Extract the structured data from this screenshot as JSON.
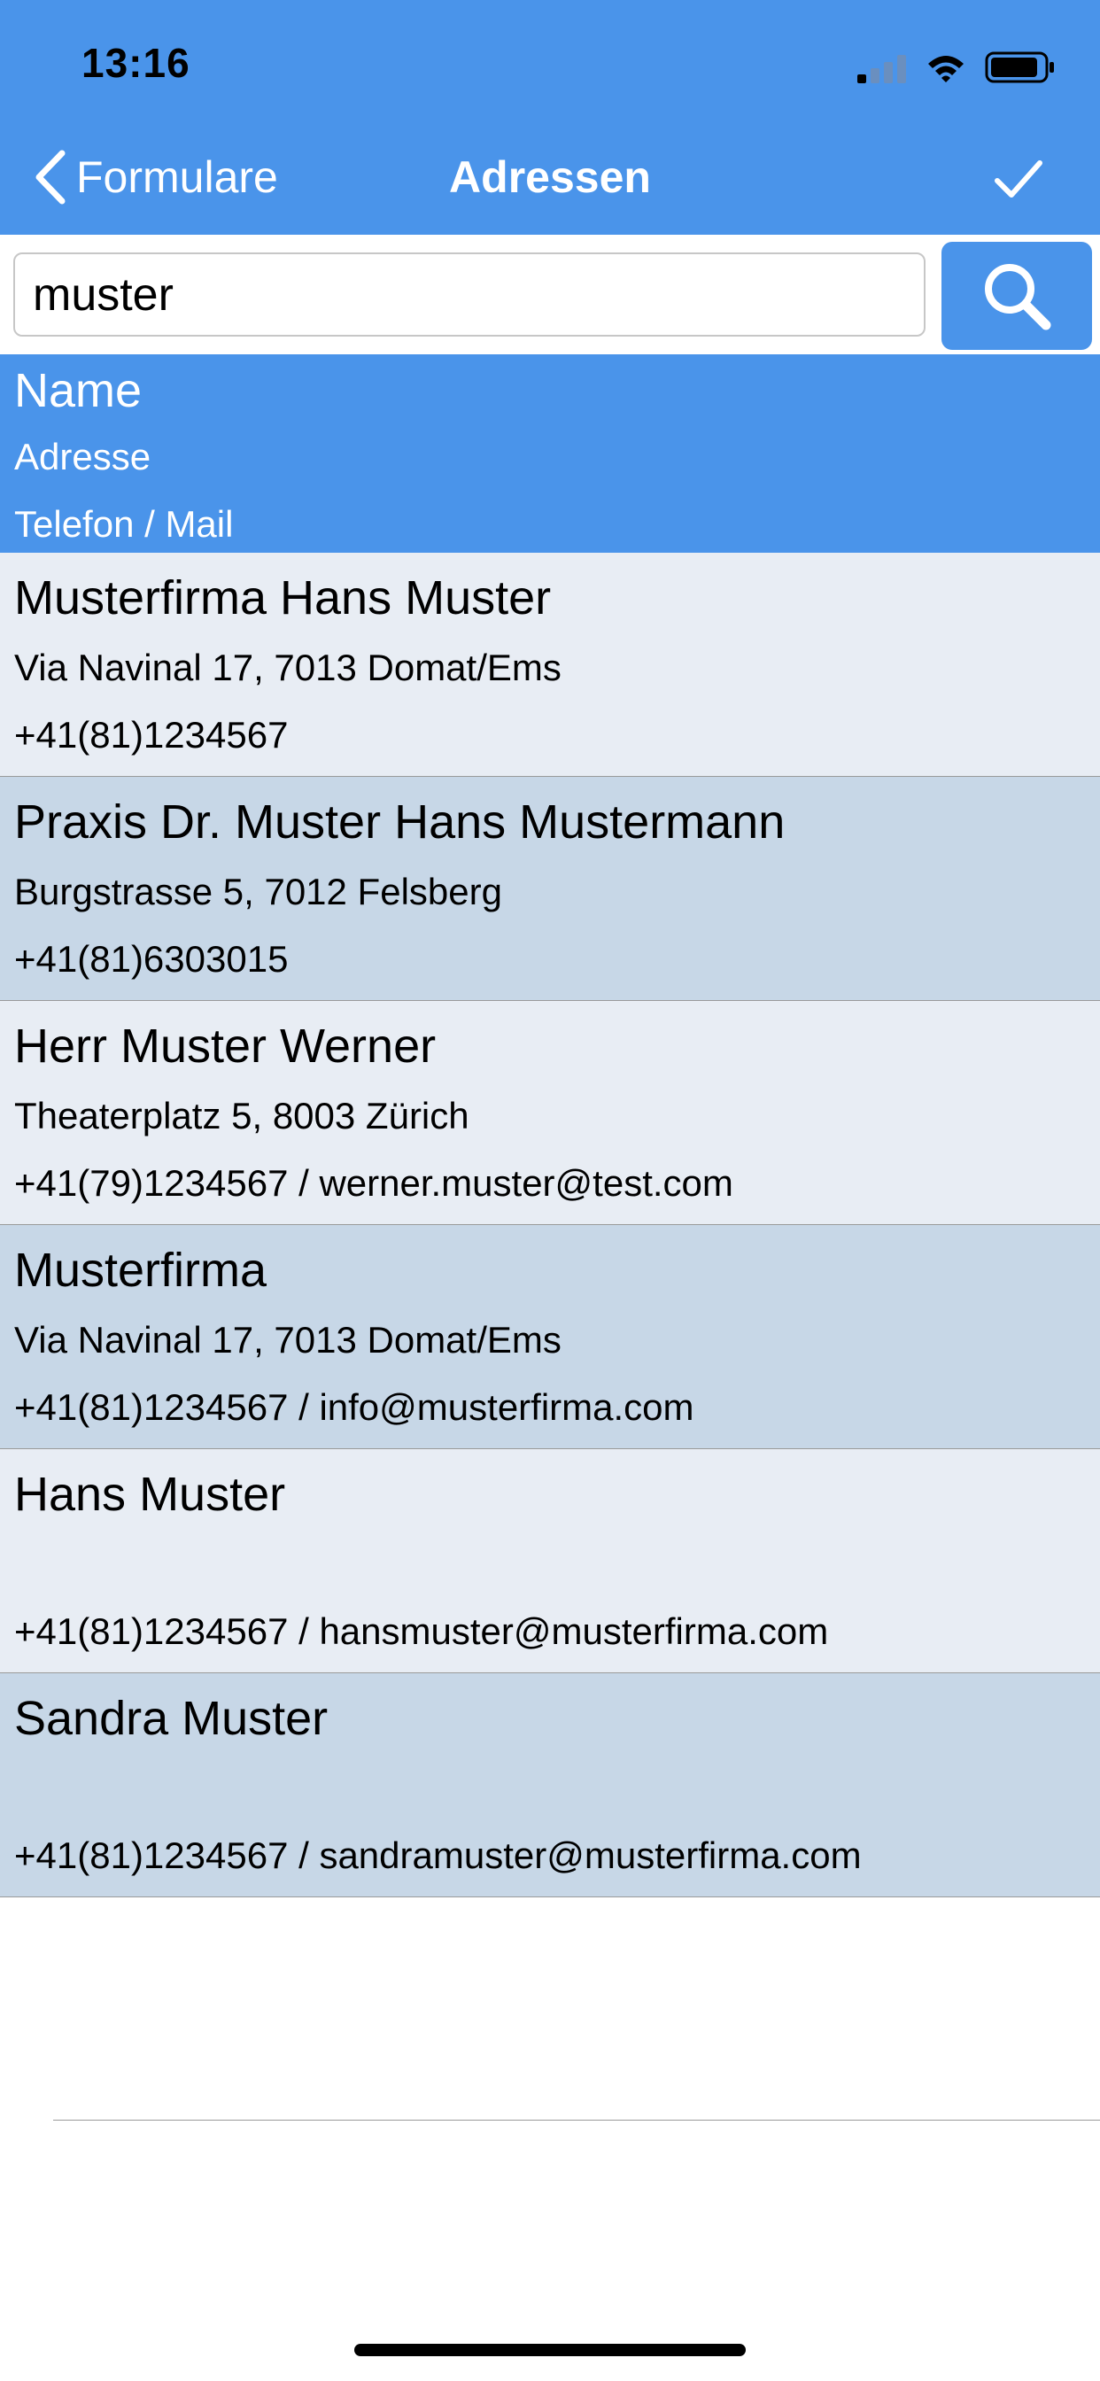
{
  "status_bar": {
    "time": "13:16"
  },
  "nav": {
    "back_label": "Formulare",
    "title": "Adressen"
  },
  "search": {
    "value": "muster",
    "placeholder": ""
  },
  "list_header": {
    "name": "Name",
    "address": "Adresse",
    "contact": "Telefon / Mail"
  },
  "rows": [
    {
      "name": "Musterfirma Hans Muster",
      "address": "Via Navinal 17, 7013 Domat/Ems",
      "contact": "+41(81)1234567"
    },
    {
      "name": "Praxis Dr. Muster Hans Mustermann",
      "address": "Burgstrasse 5, 7012 Felsberg",
      "contact": "+41(81)6303015"
    },
    {
      "name": "Herr Muster Werner",
      "address": "Theaterplatz 5, 8003 Zürich",
      "contact": "+41(79)1234567 / werner.muster@test.com"
    },
    {
      "name": "Musterfirma",
      "address": "Via Navinal 17, 7013 Domat/Ems",
      "contact": "+41(81)1234567 / info@musterfirma.com"
    },
    {
      "name": "Hans Muster",
      "address": "",
      "contact": "+41(81)1234567 / hansmuster@musterfirma.com"
    },
    {
      "name": "Sandra Muster",
      "address": "",
      "contact": "+41(81)1234567 / sandramuster@musterfirma.com"
    }
  ],
  "colors": {
    "accent": "#4a94ea",
    "row_odd": "#e8edf4",
    "row_even": "#c7d7e7"
  },
  "icons": {
    "back": "chevron-left-icon",
    "done": "checkmark-icon",
    "search": "search-icon",
    "signal": "cellular-signal-icon",
    "wifi": "wifi-icon",
    "battery": "battery-icon"
  }
}
